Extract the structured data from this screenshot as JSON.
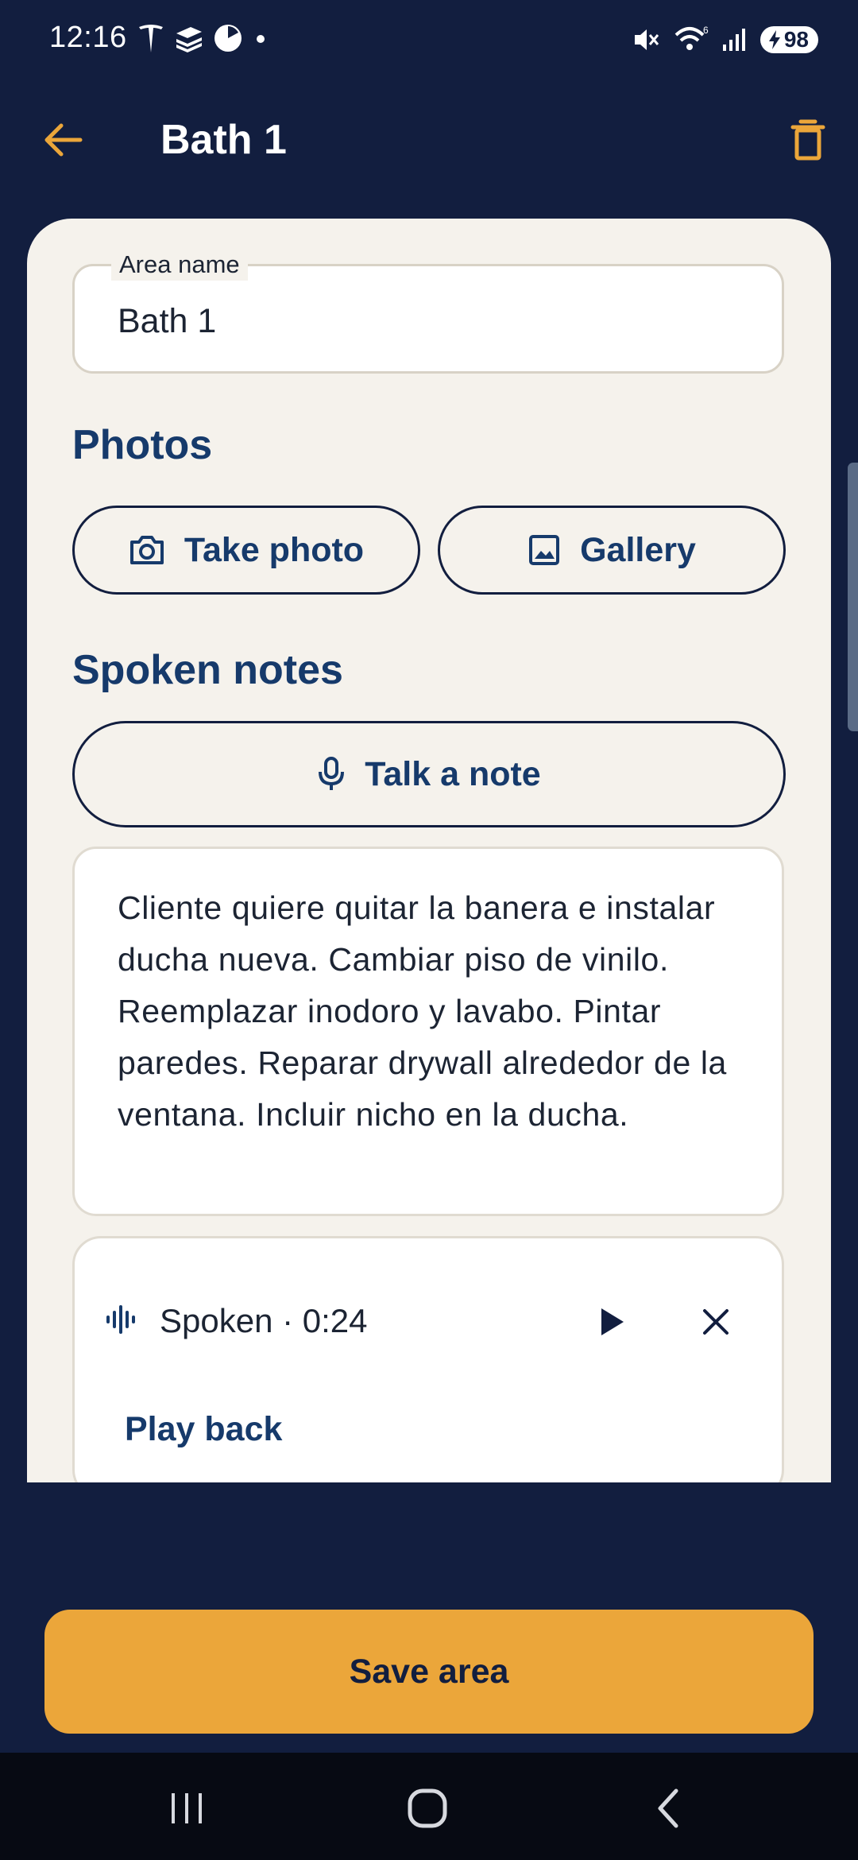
{
  "status_bar": {
    "time": "12:16",
    "battery": "98",
    "icons": [
      "tesla-icon",
      "stack-icon",
      "pie-icon",
      "dot-icon",
      "mute-icon",
      "wifi-icon",
      "signal-icon",
      "battery-icon"
    ]
  },
  "app_bar": {
    "title": "Bath 1",
    "back_icon": "arrow-left-icon",
    "delete_icon": "trash-icon"
  },
  "area_field": {
    "label": "Area name",
    "value": "Bath 1"
  },
  "photos": {
    "heading": "Photos",
    "take_photo_label": "Take photo",
    "gallery_label": "Gallery"
  },
  "spoken_notes": {
    "heading": "Spoken notes",
    "talk_label": "Talk a note",
    "note_text": "Cliente quiere quitar la banera e instalar ducha nueva. Cambiar piso de vinilo. Reemplazar inodoro y lavabo. Pintar paredes. Reparar drywall alrededor de la ventana. Incluir nicho en la ducha."
  },
  "recording": {
    "label": "Spoken · 0:24",
    "play_back_label": "Play back"
  },
  "save_label": "Save area",
  "colors": {
    "background": "#121e3f",
    "card": "#f5f2ec",
    "accent": "#eba63a",
    "heading": "#163a6b"
  }
}
